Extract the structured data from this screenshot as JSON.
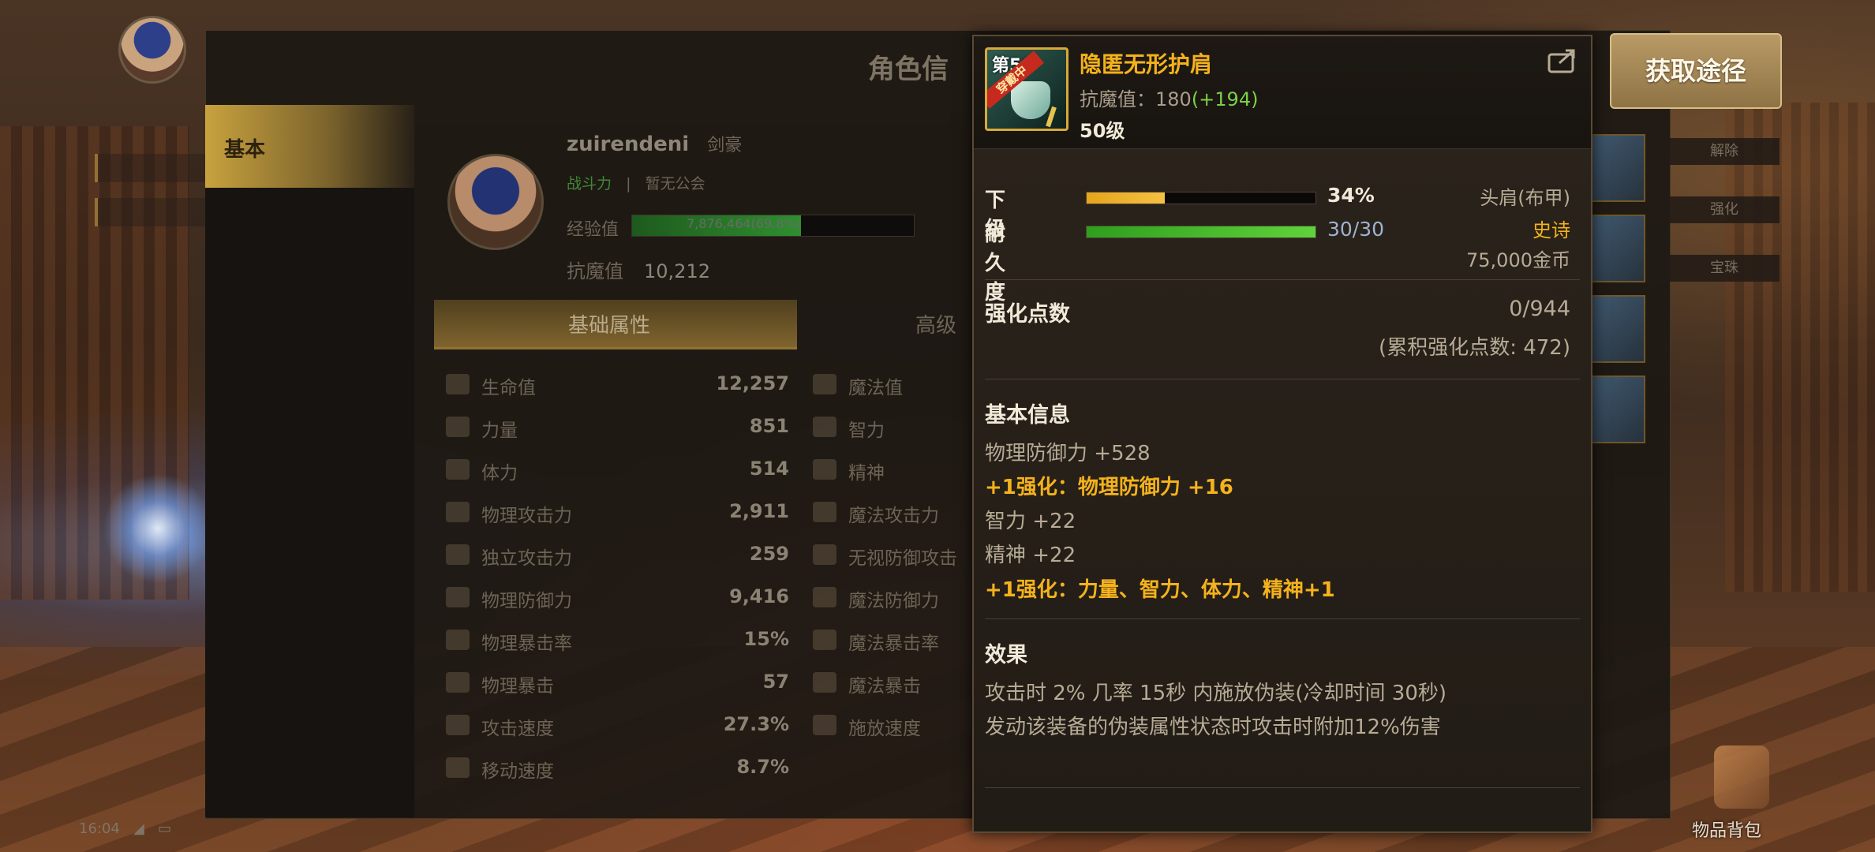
{
  "character": {
    "window_title": "角色信",
    "tab_basic": "基本",
    "name": "zuirendeni",
    "name_suffix": "剑豪",
    "power_tag": "战斗力",
    "guild_tag": "暂无公会",
    "exp_label": "经验值",
    "exp_text": "7,876,464(69.8%)",
    "resistance_label": "抗魔值",
    "resistance_value": "10,212",
    "subtab_basic_attrs": "基础属性",
    "subtab_advanced": "高级"
  },
  "stats_left": [
    {
      "name": "生命值",
      "value": "12,257"
    },
    {
      "name": "力量",
      "value": "851"
    },
    {
      "name": "体力",
      "value": "514"
    },
    {
      "name": "物理攻击力",
      "value": "2,911"
    },
    {
      "name": "独立攻击力",
      "value": "259"
    },
    {
      "name": "物理防御力",
      "value": "9,416"
    },
    {
      "name": "物理暴击率",
      "value": "15%"
    },
    {
      "name": "物理暴击",
      "value": "57"
    },
    {
      "name": "攻击速度",
      "value": "27.3%"
    },
    {
      "name": "移动速度",
      "value": "8.7%"
    }
  ],
  "stats_right": [
    {
      "name": "魔法值"
    },
    {
      "name": "智力"
    },
    {
      "name": "精神"
    },
    {
      "name": "魔法攻击力"
    },
    {
      "name": "无视防御攻击"
    },
    {
      "name": "魔法防御力"
    },
    {
      "name": "魔法暴击率"
    },
    {
      "name": "魔法暴击"
    },
    {
      "name": "施放速度"
    }
  ],
  "tooltip": {
    "icon_level": "第50",
    "equipped_ribbon": "穿戴中",
    "item_name": "隐匿无形护肩",
    "resistance_label": "抗魔值：",
    "resistance_base": "180",
    "resistance_bonus": "(+194)",
    "level": "50级",
    "grade_label": "下级",
    "grade_value": "34%",
    "grade_progress": 0.34,
    "durability_label": "耐久度",
    "durability_value": "30/30",
    "durability_progress": 1.0,
    "slot": "头肩(布甲)",
    "rarity": "史诗",
    "price": "75,000金币",
    "enhance_title": "强化点数",
    "enhance_value": "0/944",
    "enhance_total": "(累积强化点数: 472)",
    "basic_info_title": "基本信息",
    "basic_lines": [
      {
        "text": "物理防御力 +528",
        "style": "grey"
      },
      {
        "text": "+1强化：物理防御力 +16",
        "style": "gold"
      },
      {
        "text": "智力 +22",
        "style": "grey"
      },
      {
        "text": "精神 +22",
        "style": "grey"
      },
      {
        "text": "+1强化：力量、智力、体力、精神+1",
        "style": "gold"
      }
    ],
    "effect_title": "效果",
    "effect_lines": [
      "攻击时 2% 几率 15秒 内施放伪装(冷却时间 30秒)",
      "发动该装备的伪装属性状态时攻击时附加12%伤害"
    ]
  },
  "acquire_button": "获取途径",
  "status_time": "16:04",
  "bag_label": "物品背包",
  "right_badges": [
    "解除",
    "强化",
    "宝珠"
  ],
  "colors": {
    "gold": "#f4b21c",
    "green_bonus": "#7bd146",
    "bar_yellow": "#e5a51c",
    "bar_green": "#4cc22c"
  }
}
